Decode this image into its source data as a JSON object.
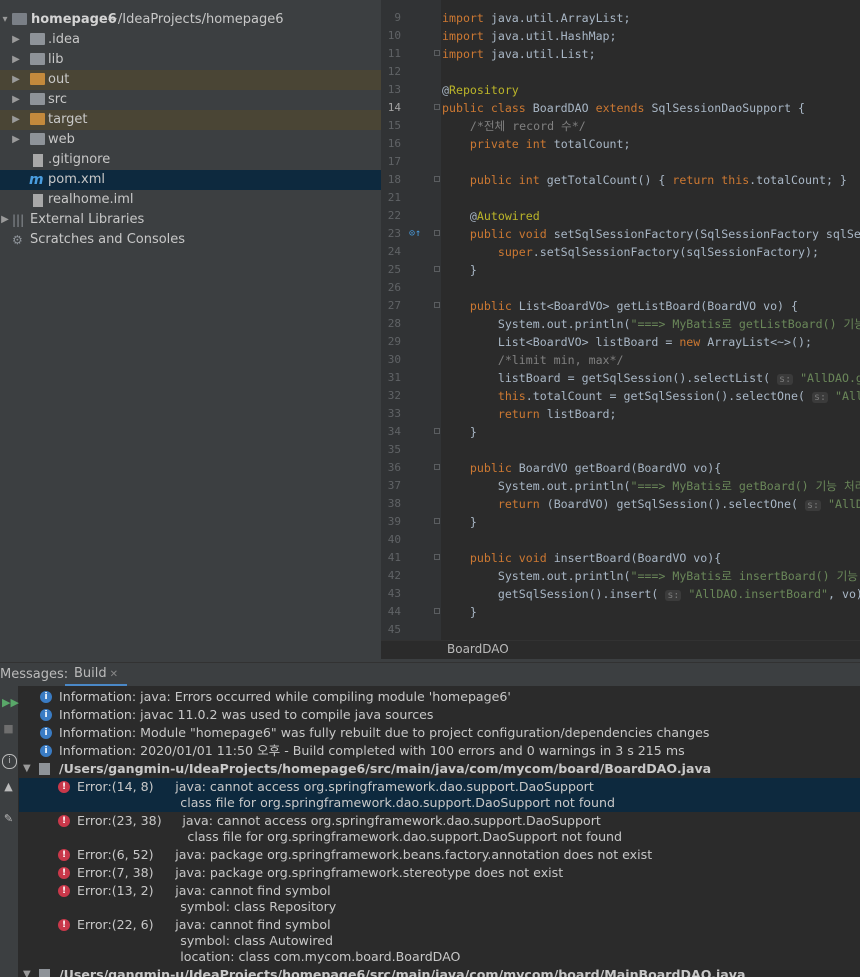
{
  "project": {
    "root_name": "homepage6",
    "root_path": "~/IdeaProjects/homepage6",
    "items": [
      {
        "label": "homepage6",
        "icon": "module-folder-icon"
      },
      {
        "label": ".idea",
        "icon": "folder-icon"
      },
      {
        "label": "lib",
        "icon": "folder-icon"
      },
      {
        "label": "out",
        "icon": "excluded-folder-icon"
      },
      {
        "label": "src",
        "icon": "folder-icon"
      },
      {
        "label": "target",
        "icon": "excluded-folder-icon"
      },
      {
        "label": "web",
        "icon": "folder-icon"
      },
      {
        "label": ".gitignore",
        "icon": "file-icon"
      },
      {
        "label": "pom.xml",
        "icon": "maven-icon"
      },
      {
        "label": "realhome.iml",
        "icon": "file-icon"
      },
      {
        "label": "External Libraries",
        "icon": "libraries-icon"
      },
      {
        "label": "Scratches and Consoles",
        "icon": "scratches-icon"
      }
    ]
  },
  "editor": {
    "breadcrumb": "BoardDAO",
    "current_line": 14,
    "lines": [
      {
        "n": "9",
        "text": "import java.util.ArrayList;"
      },
      {
        "n": "10",
        "text": "import java.util.HashMap;"
      },
      {
        "n": "11",
        "text": "import java.util.List;"
      },
      {
        "n": "12",
        "text": ""
      },
      {
        "n": "13",
        "text": "@Repository"
      },
      {
        "n": "14",
        "text": "public class BoardDAO extends SqlSessionDaoSupport {"
      },
      {
        "n": "15",
        "text": "    /*전체 record 수*/"
      },
      {
        "n": "16",
        "text": "    private int totalCount;"
      },
      {
        "n": "17",
        "text": ""
      },
      {
        "n": "18",
        "text": "    public int getTotalCount() { return this.totalCount; }"
      },
      {
        "n": "21",
        "text": ""
      },
      {
        "n": "22",
        "text": "    @Autowired"
      },
      {
        "n": "23",
        "text": "    public void setSqlSessionFactory(SqlSessionFactory sqlSe"
      },
      {
        "n": "24",
        "text": "        super.setSqlSessionFactory(sqlSessionFactory);"
      },
      {
        "n": "25",
        "text": "    }"
      },
      {
        "n": "26",
        "text": ""
      },
      {
        "n": "27",
        "text": "    public List<BoardVO> getListBoard(BoardVO vo) {"
      },
      {
        "n": "28",
        "text": "        System.out.println(\"===> MyBatis로 getListBoard() 기능"
      },
      {
        "n": "29",
        "text": "        List<BoardVO> listBoard = new ArrayList<~>();"
      },
      {
        "n": "30",
        "text": "        /*limit min, max*/"
      },
      {
        "n": "31",
        "text": "        listBoard = getSqlSession().selectList( s: \"AllDAO.ge"
      },
      {
        "n": "32",
        "text": "        this.totalCount = getSqlSession().selectOne( s: \"AllD"
      },
      {
        "n": "33",
        "text": "        return listBoard;"
      },
      {
        "n": "34",
        "text": "    }"
      },
      {
        "n": "35",
        "text": ""
      },
      {
        "n": "36",
        "text": "    public BoardVO getBoard(BoardVO vo){"
      },
      {
        "n": "37",
        "text": "        System.out.println(\"===> MyBatis로 getBoard() 기능 처리"
      },
      {
        "n": "38",
        "text": "        return (BoardVO) getSqlSession().selectOne( s: \"AllDA"
      },
      {
        "n": "39",
        "text": "    }"
      },
      {
        "n": "40",
        "text": ""
      },
      {
        "n": "41",
        "text": "    public void insertBoard(BoardVO vo){"
      },
      {
        "n": "42",
        "text": "        System.out.println(\"===> MyBatis로 insertBoard() 기능"
      },
      {
        "n": "43",
        "text": "        getSqlSession().insert( s: \"AllDAO.insertBoard\", vo);"
      },
      {
        "n": "44",
        "text": "    }"
      },
      {
        "n": "45",
        "text": ""
      }
    ]
  },
  "messages": {
    "title": "Messages:",
    "tab": "Build",
    "rows": [
      {
        "type": "info",
        "text": "Information: java: Errors occurred while compiling module 'homepage6'"
      },
      {
        "type": "info",
        "text": "Information: javac 11.0.2 was used to compile java sources"
      },
      {
        "type": "info",
        "text": "Information: Module \"homepage6\" was fully rebuilt due to project configuration/dependencies changes"
      },
      {
        "type": "info",
        "text": "Information: 2020/01/01 11:50 오후 - Build completed with 100 errors and 0 warnings in 3 s 215 ms"
      },
      {
        "type": "file",
        "text": "/Users/gangmin-u/IdeaProjects/homepage6/src/main/java/com/mycom/board/BoardDAO.java"
      },
      {
        "type": "error",
        "loc": "Error:(14, 8)",
        "text": "java: cannot access org.springframework.dao.support.DaoSupport",
        "sub": [
          "class file for org.springframework.dao.support.DaoSupport not found"
        ],
        "selected": true
      },
      {
        "type": "error",
        "loc": "Error:(23, 38)",
        "text": "java: cannot access org.springframework.dao.support.DaoSupport",
        "sub": [
          "class file for org.springframework.dao.support.DaoSupport not found"
        ]
      },
      {
        "type": "error",
        "loc": "Error:(6, 52)",
        "text": "java: package org.springframework.beans.factory.annotation does not exist",
        "sub": []
      },
      {
        "type": "error",
        "loc": "Error:(7, 38)",
        "text": "java: package org.springframework.stereotype does not exist",
        "sub": []
      },
      {
        "type": "error",
        "loc": "Error:(13, 2)",
        "text": "java: cannot find symbol",
        "sub": [
          "symbol: class Repository"
        ]
      },
      {
        "type": "error",
        "loc": "Error:(22, 6)",
        "text": "java: cannot find symbol",
        "sub": [
          "symbol:   class Autowired",
          "location: class com.mycom.board.BoardDAO"
        ]
      },
      {
        "type": "file",
        "text": "/Users/gangmin-u/IdeaProjects/homepage6/src/main/java/com/mycom/board/MainBoardDAO.java"
      }
    ]
  },
  "colors": {
    "accent": "#4a88c7",
    "error": "#c9384a",
    "info": "#3a7cc4"
  }
}
